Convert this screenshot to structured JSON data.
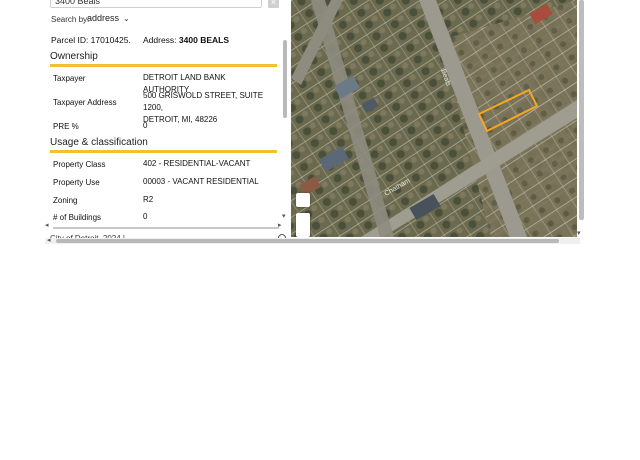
{
  "search": {
    "value": "3400 Beals",
    "clear_label": "×",
    "search_by_label": "Search by:",
    "search_by_value": "address"
  },
  "parcel": {
    "id_text": "Parcel ID: 17010425.",
    "address_label": "Address:",
    "address_value": "3400 BEALS"
  },
  "ownership": {
    "title": "Ownership",
    "rows": [
      {
        "label": "Taxpayer",
        "value": "DETROIT LAND BANK AUTHORITY"
      },
      {
        "label": "Taxpayer Address",
        "value_line1": "500 GRISWOLD STREET, SUITE 1200,",
        "value_line2": "DETROIT, MI, 48226"
      },
      {
        "label": "PRE %",
        "value": "0"
      }
    ]
  },
  "usage": {
    "title": "Usage & classification",
    "rows": [
      {
        "label": "Property Class",
        "value": "402 - RESIDENTIAL-VACANT"
      },
      {
        "label": "Property Use",
        "value": "00003 - VACANT RESIDENTIAL"
      },
      {
        "label": "Zoning",
        "value": "R2"
      },
      {
        "label": "# of Buildings",
        "value": "0"
      }
    ]
  },
  "footer": {
    "text": "City of Detroit, 2024 | ..."
  },
  "map": {
    "street_labels": [
      "Beals",
      "Chatham"
    ],
    "parcel_highlight_color": "#f5a623"
  },
  "colors": {
    "accent": "#f2c12e"
  }
}
